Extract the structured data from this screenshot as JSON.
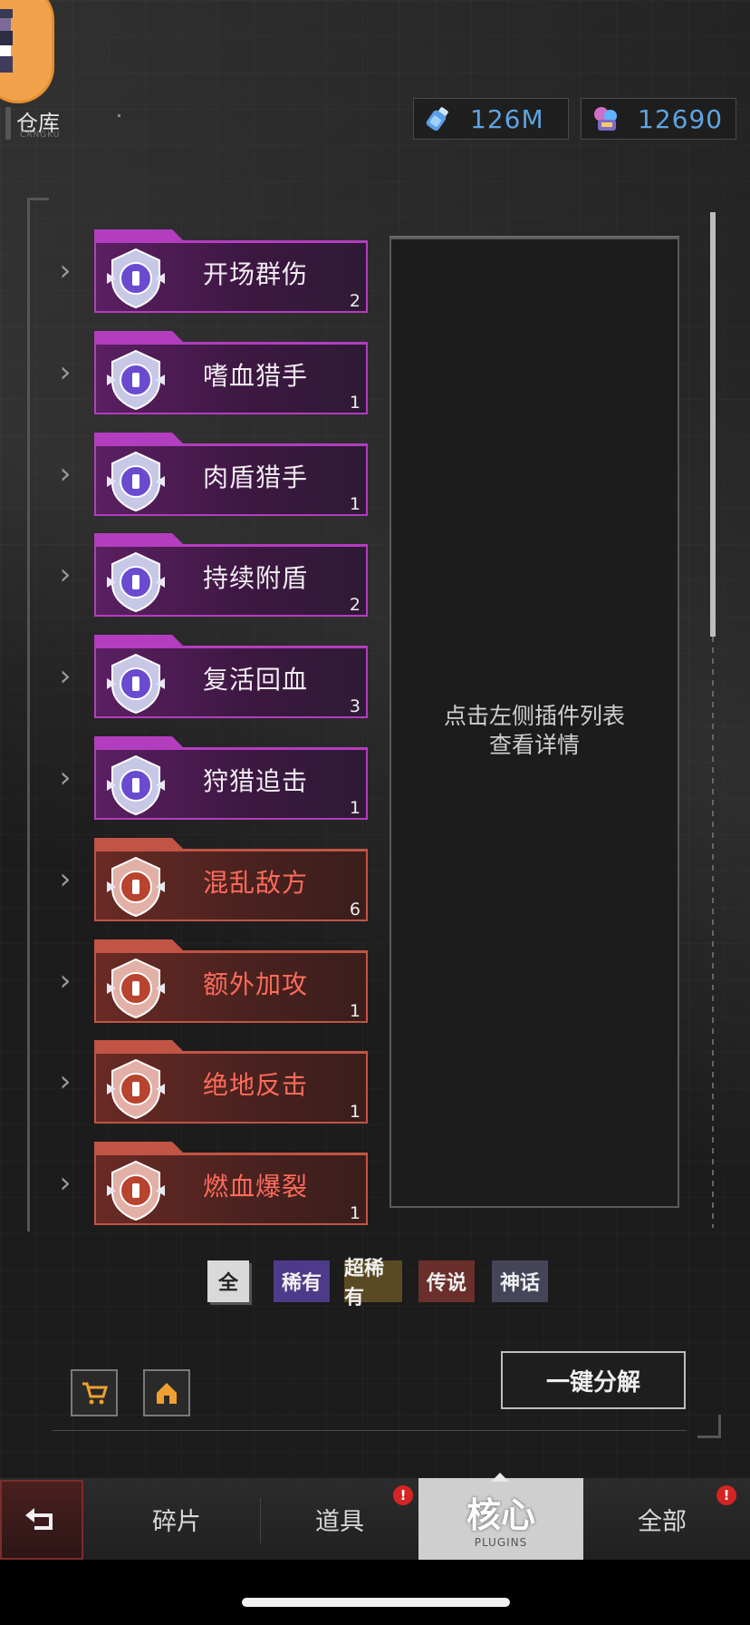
{
  "header": {
    "title": "仓库",
    "subtitle": "CANGKU"
  },
  "currencies": [
    {
      "icon": "potion-bottle-icon",
      "value": "126M"
    },
    {
      "icon": "chip-crystal-icon",
      "value": "12690"
    }
  ],
  "plugins": [
    {
      "name": "开场群伤",
      "count": "2",
      "rarity": "purple",
      "icon": "tower-emblem-icon"
    },
    {
      "name": "嗜血猎手",
      "count": "1",
      "rarity": "purple",
      "icon": "rose-emblem-icon"
    },
    {
      "name": "肉盾猎手",
      "count": "1",
      "rarity": "purple",
      "icon": "armor-emblem-icon"
    },
    {
      "name": "持续附盾",
      "count": "2",
      "rarity": "purple",
      "icon": "shield-emblem-icon"
    },
    {
      "name": "复活回血",
      "count": "3",
      "rarity": "purple",
      "icon": "wings-emblem-icon"
    },
    {
      "name": "狩猎追击",
      "count": "1",
      "rarity": "purple",
      "icon": "sword-emblem-icon"
    },
    {
      "name": "混乱敌方",
      "count": "6",
      "rarity": "red",
      "icon": "chaos-emblem-icon"
    },
    {
      "name": "额外加攻",
      "count": "1",
      "rarity": "red",
      "icon": "blade-emblem-icon"
    },
    {
      "name": "绝地反击",
      "count": "1",
      "rarity": "red",
      "icon": "flame-emblem-icon"
    },
    {
      "name": "燃血爆裂",
      "count": "1",
      "rarity": "red",
      "icon": "blood-emblem-icon"
    }
  ],
  "detail": {
    "line1": "点击左侧插件列表",
    "line2": "查看详情"
  },
  "filters": [
    {
      "label": "全",
      "color": "#d9d9d9",
      "text": "#222222"
    },
    {
      "label": "稀有",
      "color": "#4d3a8a",
      "text": "#f0f0f0"
    },
    {
      "label": "超稀有",
      "color": "#5a4a24",
      "text": "#f0f0f0"
    },
    {
      "label": "传说",
      "color": "#6a2f2a",
      "text": "#f0f0f0"
    },
    {
      "label": "神话",
      "color": "#45455a",
      "text": "#f0f0f0"
    }
  ],
  "tools": {
    "shop_icon": "cart-icon",
    "home_icon": "home-icon",
    "decompose_label": "一键分解"
  },
  "nav": {
    "tabs": [
      "碎片",
      "道具",
      "核心",
      "全部"
    ],
    "active_sub": "PLUGINS"
  },
  "alert_mark": "!"
}
